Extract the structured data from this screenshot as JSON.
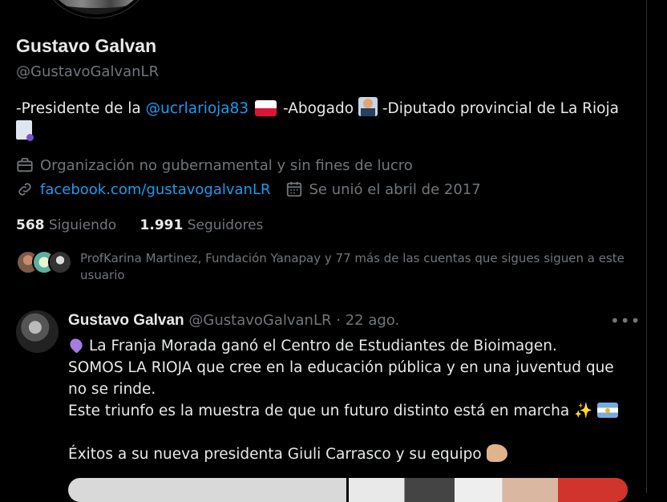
{
  "profile": {
    "name": "Gustavo Galvan",
    "handle": "@GustavoGalvanLR",
    "bio": {
      "part1": "-Presidente de la ",
      "mention": "@ucrlarioja83",
      "part2": " -Abogado ",
      "part3": " -Diputado provincial de La Rioja",
      "emoji_flag": "flag-poland-icon",
      "emoji_lawyer": "lawyer-icon",
      "emoji_doc": "document-icon"
    },
    "category": "Organización no gubernamental y sin fines de lucro",
    "website": "facebook.com/gustavogalvanLR",
    "joined": "Se unió el abril de 2017",
    "following_count": "568",
    "following_label": "Siguiendo",
    "followers_count": "1.991",
    "followers_label": "Seguidores",
    "followed_by_text": "ProfKarina Martinez, Fundación Yanapay y 77 más de las cuentas que sigues siguen a este usuario"
  },
  "tweet": {
    "name": "Gustavo Galvan",
    "handle": "@GustavoGalvanLR",
    "separator": "·",
    "date": "22 ago.",
    "more": "•••",
    "line1": "La Franja Morada ganó el Centro de Estudiantes de Bioimagen.",
    "line2": "SOMOS LA RIOJA que cree en la educación pública y en una juventud que no se rinde.",
    "line3": "Este triunfo es la muestra de que un futuro distinto está en marcha ",
    "line3_emoji": "✨",
    "line4": "Éxitos a su nueva presidenta Giuli Carrasco y su equipo "
  },
  "colors": {
    "background": "#000000",
    "text": "#e7e9ea",
    "secondary": "#71767b",
    "link": "#1d9bf0"
  }
}
